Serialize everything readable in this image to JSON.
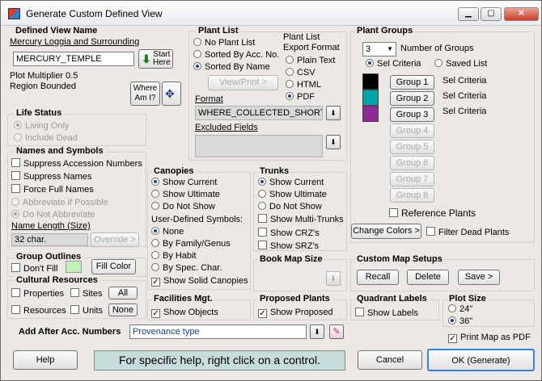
{
  "window": {
    "title": "Generate Custom Defined View"
  },
  "defined_view": {
    "header": "Defined View Name",
    "subtitle": "Mercury Loggia and Surrounding",
    "name_value": "MERCURY_TEMPLE",
    "start_label": "Start\nHere",
    "plot_multiplier": "Plot Multiplier 0.5",
    "region": "Region Bounded",
    "where_label": "Where\nAm I?"
  },
  "plant_list": {
    "header": "Plant List",
    "options": [
      "No Plant List",
      "Sorted By Acc. No.",
      "Sorted By Name"
    ],
    "selected": 2,
    "view_print": "View/Print >",
    "export_header": "Plant List\nExport Format",
    "export_options": [
      "Plain Text",
      "CSV",
      "HTML",
      "PDF"
    ],
    "export_selected": 3,
    "format_label": "Format",
    "format_value": "WHERE_COLLECTED_SHORT",
    "excluded_label": "Excluded Fields"
  },
  "plant_groups": {
    "header": "Plant Groups",
    "number_value": "3",
    "number_label": "Number of Groups",
    "sel_criteria": "Sel Criteria",
    "saved_list": "Saved List",
    "groups": [
      {
        "label": "Group 1",
        "color": "#000000",
        "criteria": "Sel Criteria",
        "enabled": true
      },
      {
        "label": "Group 2",
        "color": "#00a4a4",
        "criteria": "Sel Criteria",
        "enabled": true
      },
      {
        "label": "Group 3",
        "color": "#8e2a95",
        "criteria": "Sel Criteria",
        "enabled": true
      },
      {
        "label": "Group 4",
        "enabled": false
      },
      {
        "label": "Group 5",
        "enabled": false
      },
      {
        "label": "Group 6",
        "enabled": false
      },
      {
        "label": "Group 7",
        "enabled": false
      },
      {
        "label": "Group 8",
        "enabled": false
      }
    ],
    "reference_plants": "Reference Plants",
    "change_colors": "Change Colors >",
    "filter_dead": "Filter Dead Plants"
  },
  "life_status": {
    "header": "Life Status",
    "living_only": "Living Only",
    "include_dead": "Include Dead"
  },
  "names_symbols": {
    "header": "Names and Symbols",
    "suppress_acc": "Suppress Accession Numbers",
    "suppress_names": "Suppress Names",
    "force_full": "Force Full Names",
    "abbrev_possible": "Abbreviate if Possible",
    "do_not_abbrev": "Do Not Abbreviate",
    "name_length_label": "Name Length (Size)",
    "name_length_value": "32 char.",
    "override": "Override >"
  },
  "canopies": {
    "header": "Canopies",
    "options": [
      "Show Current",
      "Show Ultimate",
      "Do Not Show"
    ],
    "selected": 0,
    "user_symbols": "User-Defined Symbols:",
    "symbol_options": [
      "None",
      "By Family/Genus",
      "By Habit",
      "By Spec. Char."
    ],
    "symbol_selected": 0,
    "show_solid": "Show Solid Canopies"
  },
  "trunks": {
    "header": "Trunks",
    "options": [
      "Show Current",
      "Show Ultimate",
      "Do Not Show"
    ],
    "selected": 0,
    "show_multi": "Show Multi-Trunks",
    "show_crz": "Show CRZ's",
    "show_srz": "Show SRZ's"
  },
  "group_outlines": {
    "header": "Group Outlines",
    "dont_fill": "Don't Fill",
    "fill_color": "Fill Color",
    "fill_swatch": "#bff2b5"
  },
  "cultural_resources": {
    "header": "Cultural Resources",
    "properties": "Properties",
    "sites": "Sites",
    "all": "All",
    "resources": "Resources",
    "units": "Units",
    "none": "None"
  },
  "book_map": {
    "header": "Book Map Size"
  },
  "custom_map": {
    "header": "Custom Map Setups",
    "recall": "Recall",
    "delete": "Delete",
    "save": "Save  >"
  },
  "facilities": {
    "header": "Facilities Mgt.",
    "show_objects": "Show Objects"
  },
  "proposed": {
    "header": "Proposed Plants",
    "show_proposed": "Show Proposed"
  },
  "quadrant": {
    "header": "Quadrant Labels",
    "show_labels": "Show Labels"
  },
  "plot_size": {
    "header": "Plot Size",
    "options": [
      "24\"",
      "36\""
    ],
    "selected": 1,
    "print_pdf": "Print Map as PDF"
  },
  "add_after": {
    "label": "Add After Acc. Numbers",
    "value": "Provenance type"
  },
  "footer": {
    "help": "Help",
    "hint": "For specific help, right click on a control.",
    "cancel": "Cancel",
    "ok": "OK  (Generate)"
  },
  "colors": {
    "accent_blue": "#1c3d8c",
    "hint_bg": "#c7dcd9",
    "start_green": "#7ed36a"
  }
}
